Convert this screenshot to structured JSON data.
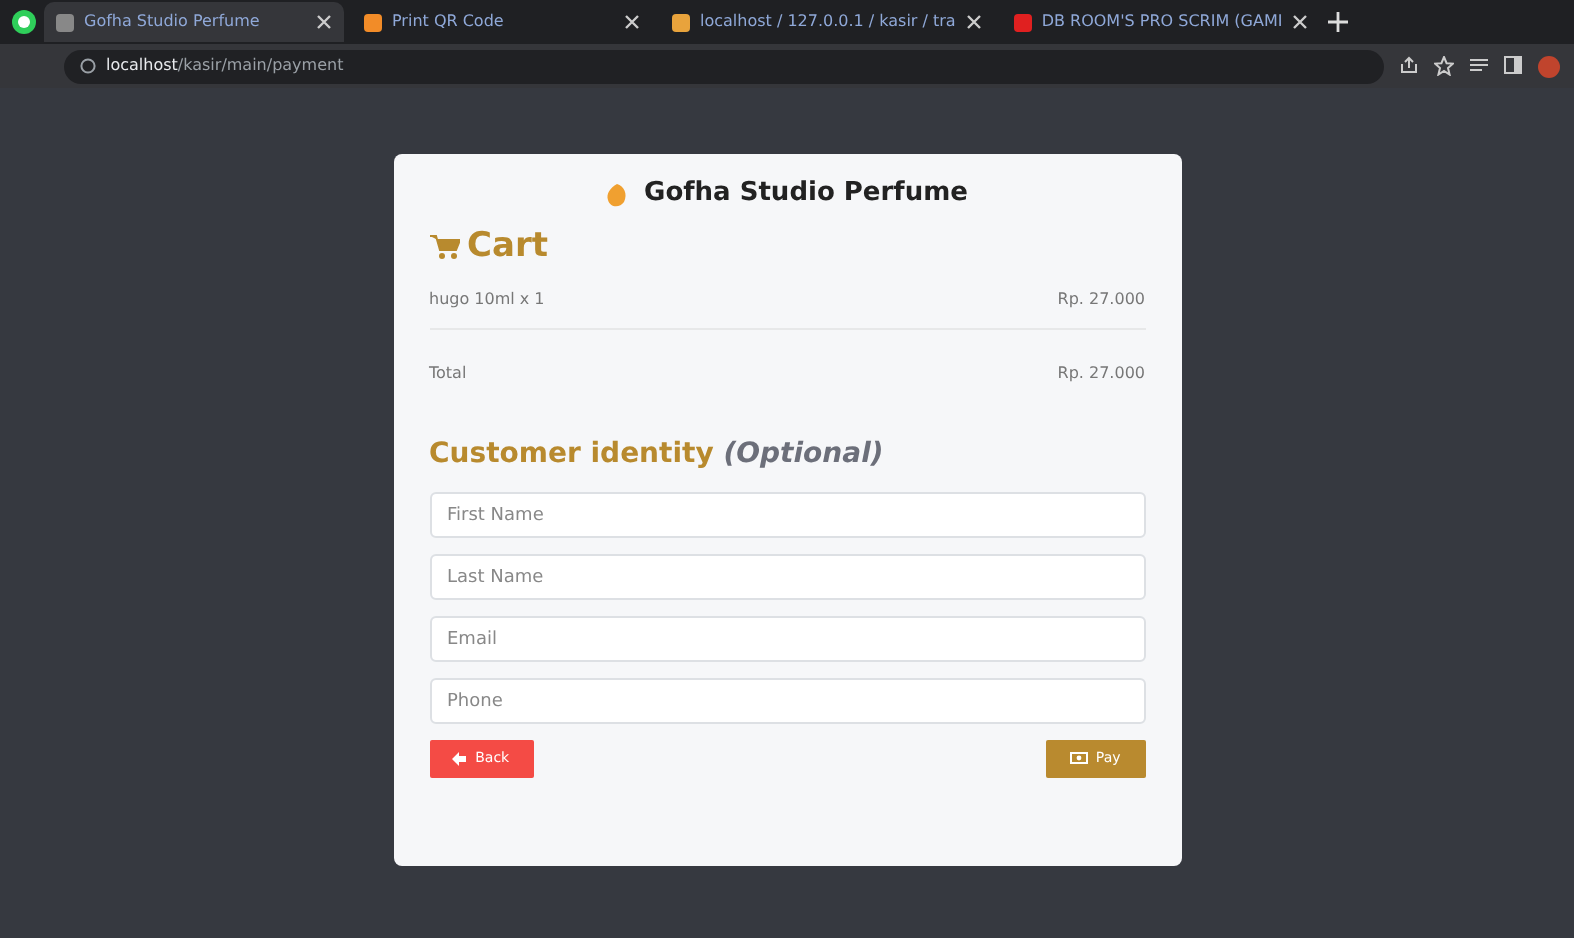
{
  "browser": {
    "tabs": [
      {
        "title": "Gofha Studio Perfume",
        "selected": true
      },
      {
        "title": "Print QR Code",
        "selected": false
      },
      {
        "title": "localhost / 127.0.0.1 / kasir / tra",
        "selected": false
      },
      {
        "title": "DB ROOM'S PRO SCRIM (GAMI",
        "selected": false
      }
    ],
    "url_host": "localhost",
    "url_path": "/kasir/main/payment"
  },
  "shop_name": "Gofha Studio Perfume",
  "cart": {
    "title": "Cart",
    "items": [
      {
        "name": "hugo 10ml x 1",
        "price": "Rp. 27.000"
      }
    ],
    "total_label": "Total",
    "total": "Rp. 27.000"
  },
  "identity": {
    "title": "Customer identity",
    "optional": "(Optional)",
    "fields": [
      {
        "placeholder": "First Name"
      },
      {
        "placeholder": "Last Name"
      },
      {
        "placeholder": "Email"
      },
      {
        "placeholder": "Phone"
      }
    ]
  },
  "buttons": [
    {
      "kind": "back",
      "label": "Back"
    },
    {
      "kind": "pay",
      "label": "Pay"
    }
  ]
}
